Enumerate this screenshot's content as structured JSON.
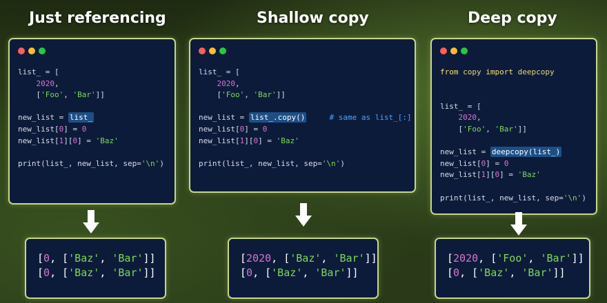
{
  "colors": {
    "dot_red": "#ff5f56",
    "dot_yellow": "#ffbd2e",
    "dot_green": "#27c93f",
    "panel_bg": "#0d1b3b",
    "panel_border": "#c6d88a",
    "number": "#d774d0",
    "string": "#7ed957",
    "comment": "#4aa3ff",
    "highlight": "#1d4f86"
  },
  "columns": [
    {
      "title": "Just referencing",
      "code": {
        "l1": "list_ = [",
        "l2_num": "2020",
        "l3_s1": "'Foo'",
        "l3_s2": "'Bar'",
        "l5_pre": "new_list = ",
        "l5_hl": "list_",
        "l6_pre": "new_list[",
        "l6_i": "0",
        "l6_mid": "] = ",
        "l6_v": "0",
        "l7_pre": "new_list[",
        "l7_i1": "1",
        "l7_mid": "][",
        "l7_i2": "0",
        "l7_mid2": "] = ",
        "l7_v": "'Baz'",
        "l9_pre": "print(list_, new_list, sep=",
        "l9_s": "'\\n'",
        "l9_post": ")"
      },
      "output": {
        "r1_a": "0",
        "r1_b": "'Baz'",
        "r1_c": "'Bar'",
        "r2_a": "0",
        "r2_b": "'Baz'",
        "r2_c": "'Bar'"
      }
    },
    {
      "title": "Shallow copy",
      "code": {
        "l1": "list_ = [",
        "l2_num": "2020",
        "l3_s1": "'Foo'",
        "l3_s2": "'Bar'",
        "l5_pre": "new_list = ",
        "l5_hl": "list_.copy()",
        "l5_cmt": "# same as list_[:]",
        "l6_pre": "new_list[",
        "l6_i": "0",
        "l6_mid": "] = ",
        "l6_v": "0",
        "l7_pre": "new_list[",
        "l7_i1": "1",
        "l7_mid": "][",
        "l7_i2": "0",
        "l7_mid2": "] = ",
        "l7_v": "'Baz'",
        "l9_pre": "print(list_, new_list, sep=",
        "l9_s": "'\\n'",
        "l9_post": ")"
      },
      "output": {
        "r1_a": "2020",
        "r1_b": "'Baz'",
        "r1_c": "'Bar'",
        "r2_a": "0",
        "r2_b": "'Baz'",
        "r2_c": "'Bar'"
      }
    },
    {
      "title": "Deep copy",
      "code": {
        "import_from": "from",
        "import_mod": "copy",
        "import_kw": "import",
        "import_name": "deepcopy",
        "l1": "list_ = [",
        "l2_num": "2020",
        "l3_s1": "'Foo'",
        "l3_s2": "'Bar'",
        "l5_pre": "new_list = ",
        "l5_hl": "deepcopy(list_)",
        "l6_pre": "new_list[",
        "l6_i": "0",
        "l6_mid": "] = ",
        "l6_v": "0",
        "l7_pre": "new_list[",
        "l7_i1": "1",
        "l7_mid": "][",
        "l7_i2": "0",
        "l7_mid2": "] = ",
        "l7_v": "'Baz'",
        "l9_pre": "print(list_, new_list, sep=",
        "l9_s": "'\\n'",
        "l9_post": ")"
      },
      "output": {
        "r1_a": "2020",
        "r1_b": "'Foo'",
        "r1_c": "'Bar'",
        "r2_a": "0",
        "r2_b": "'Baz'",
        "r2_c": "'Bar'"
      }
    }
  ]
}
